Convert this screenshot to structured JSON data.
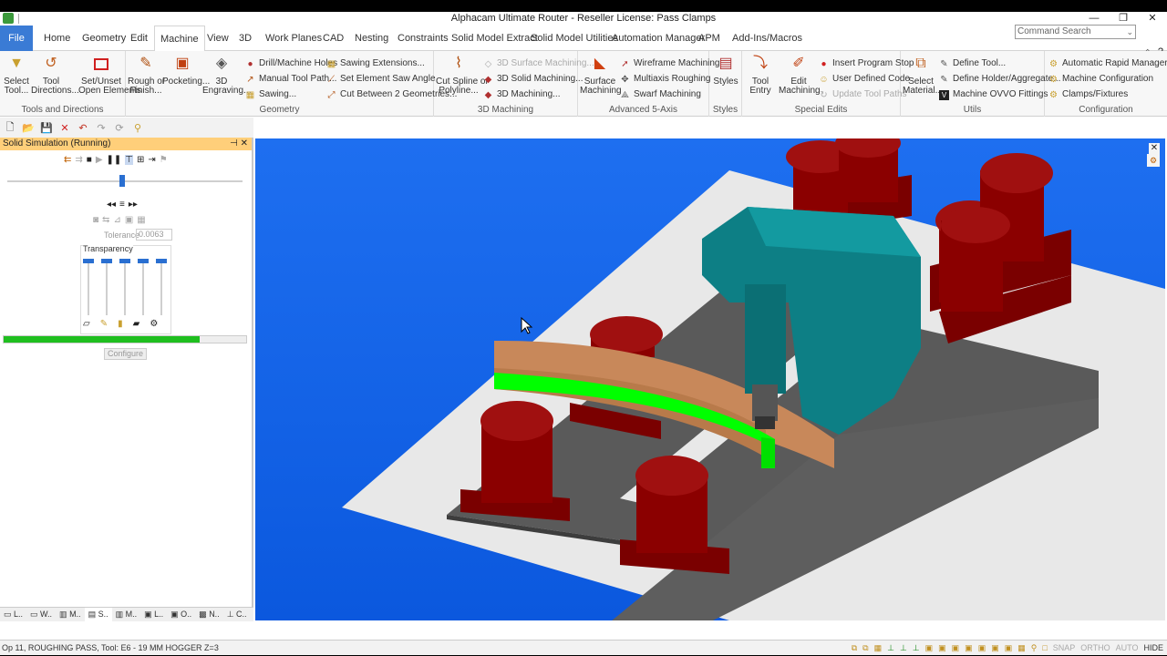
{
  "window": {
    "title": "Alphacam Ultimate Router - Reseller License: Pass Clamps",
    "controls": [
      "—",
      "❐",
      "✕"
    ]
  },
  "ribbon_tabs": [
    {
      "label": "File"
    },
    {
      "label": "Home"
    },
    {
      "label": "Geometry"
    },
    {
      "label": "Edit"
    },
    {
      "label": "Machine"
    },
    {
      "label": "View"
    },
    {
      "label": "3D"
    },
    {
      "label": "Work Planes"
    },
    {
      "label": "CAD"
    },
    {
      "label": "Nesting"
    },
    {
      "label": "Constraints"
    },
    {
      "label": "Solid Model Extract"
    },
    {
      "label": "Solid Model Utilities"
    },
    {
      "label": "Automation Manager"
    },
    {
      "label": "APM"
    },
    {
      "label": "Add-Ins/Macros"
    }
  ],
  "active_tab": "Machine",
  "command_search": {
    "placeholder": "Command Search"
  },
  "groups": {
    "tools": {
      "label": "Tools and Directions",
      "select_tool": "Select\nTool...",
      "tool_directions": "Tool\nDirections...",
      "set_unset": "Set/Unset\nOpen Elements"
    },
    "geometry": {
      "label": "Geometry",
      "rough_finish": "Rough or\nFinish...",
      "pocketing": "Pocketing...",
      "engraving": "3D\nEngraving...",
      "drill": "Drill/Machine Holes",
      "manual_tool_path": "Manual Tool Path...",
      "sawing": "Sawing...",
      "sawing_ext": "Sawing Extensions...",
      "set_saw_angle": "Set Element Saw Angle",
      "cut_between": "Cut Between 2 Geometries..."
    },
    "machining3d": {
      "label": "3D Machining",
      "cut_spline": "Cut Spline or\nPolyline...",
      "surface_machining": "3D Surface Machining...",
      "solid_machining": "3D Solid Machining...",
      "machining": "3D Machining..."
    },
    "advanced": {
      "label": "Advanced 5-Axis",
      "surface_machining": "Surface\nMachining",
      "wireframe": "Wireframe Machining",
      "multiaxis": "Multiaxis Roughing",
      "swarf": "Swarf Machining"
    },
    "styles": {
      "label": "Styles",
      "styles": "Styles"
    },
    "special": {
      "label": "Special Edits",
      "tool_entry": "Tool\nEntry",
      "edit_machining": "Edit\nMachining",
      "insert_stop": "Insert Program Stop",
      "user_code": "User Defined Code",
      "update_paths": "Update Tool Paths"
    },
    "utils": {
      "label": "Utils",
      "select_material": "Select\nMaterial...",
      "define_tool": "Define Tool...",
      "define_holder": "Define Holder/Aggregate...",
      "ovvo": "Machine OVVO Fittings"
    },
    "configuration": {
      "label": "Configuration",
      "rapid_manager": "Automatic Rapid Manager...",
      "machine_config": "Machine Configuration",
      "clamps": "Clamps/Fixtures"
    }
  },
  "sim_panel": {
    "title": "Solid Simulation (Running)",
    "tolerance_label": "Tolerance",
    "tolerance_value": "0.0063",
    "transparency_label": "Transparency",
    "configure_label": "Configure",
    "progress": 0.81,
    "speed": 0.49,
    "transparency_levels": [
      0,
      0,
      0,
      0,
      0
    ]
  },
  "panel_tabs": [
    {
      "label": "L.."
    },
    {
      "label": "W.."
    },
    {
      "label": "M.."
    },
    {
      "label": "S.."
    },
    {
      "label": "M.."
    },
    {
      "label": "L.."
    },
    {
      "label": "O.."
    },
    {
      "label": "N.."
    },
    {
      "label": "C.."
    }
  ],
  "status": {
    "text": "Op 11, ROUGHING PASS, Tool: E6 - 19 MM HOGGER Z=3",
    "modes": [
      "SNAP",
      "ORTHO",
      "AUTO",
      "HIDE"
    ]
  },
  "colors": {
    "viewport_bg": "#1466ea",
    "clamp": "#8b0000",
    "machine_head": "#0d7f85",
    "wood": "#c8885a",
    "toolpath": "#00ff00",
    "table": "#5a5a5a"
  }
}
